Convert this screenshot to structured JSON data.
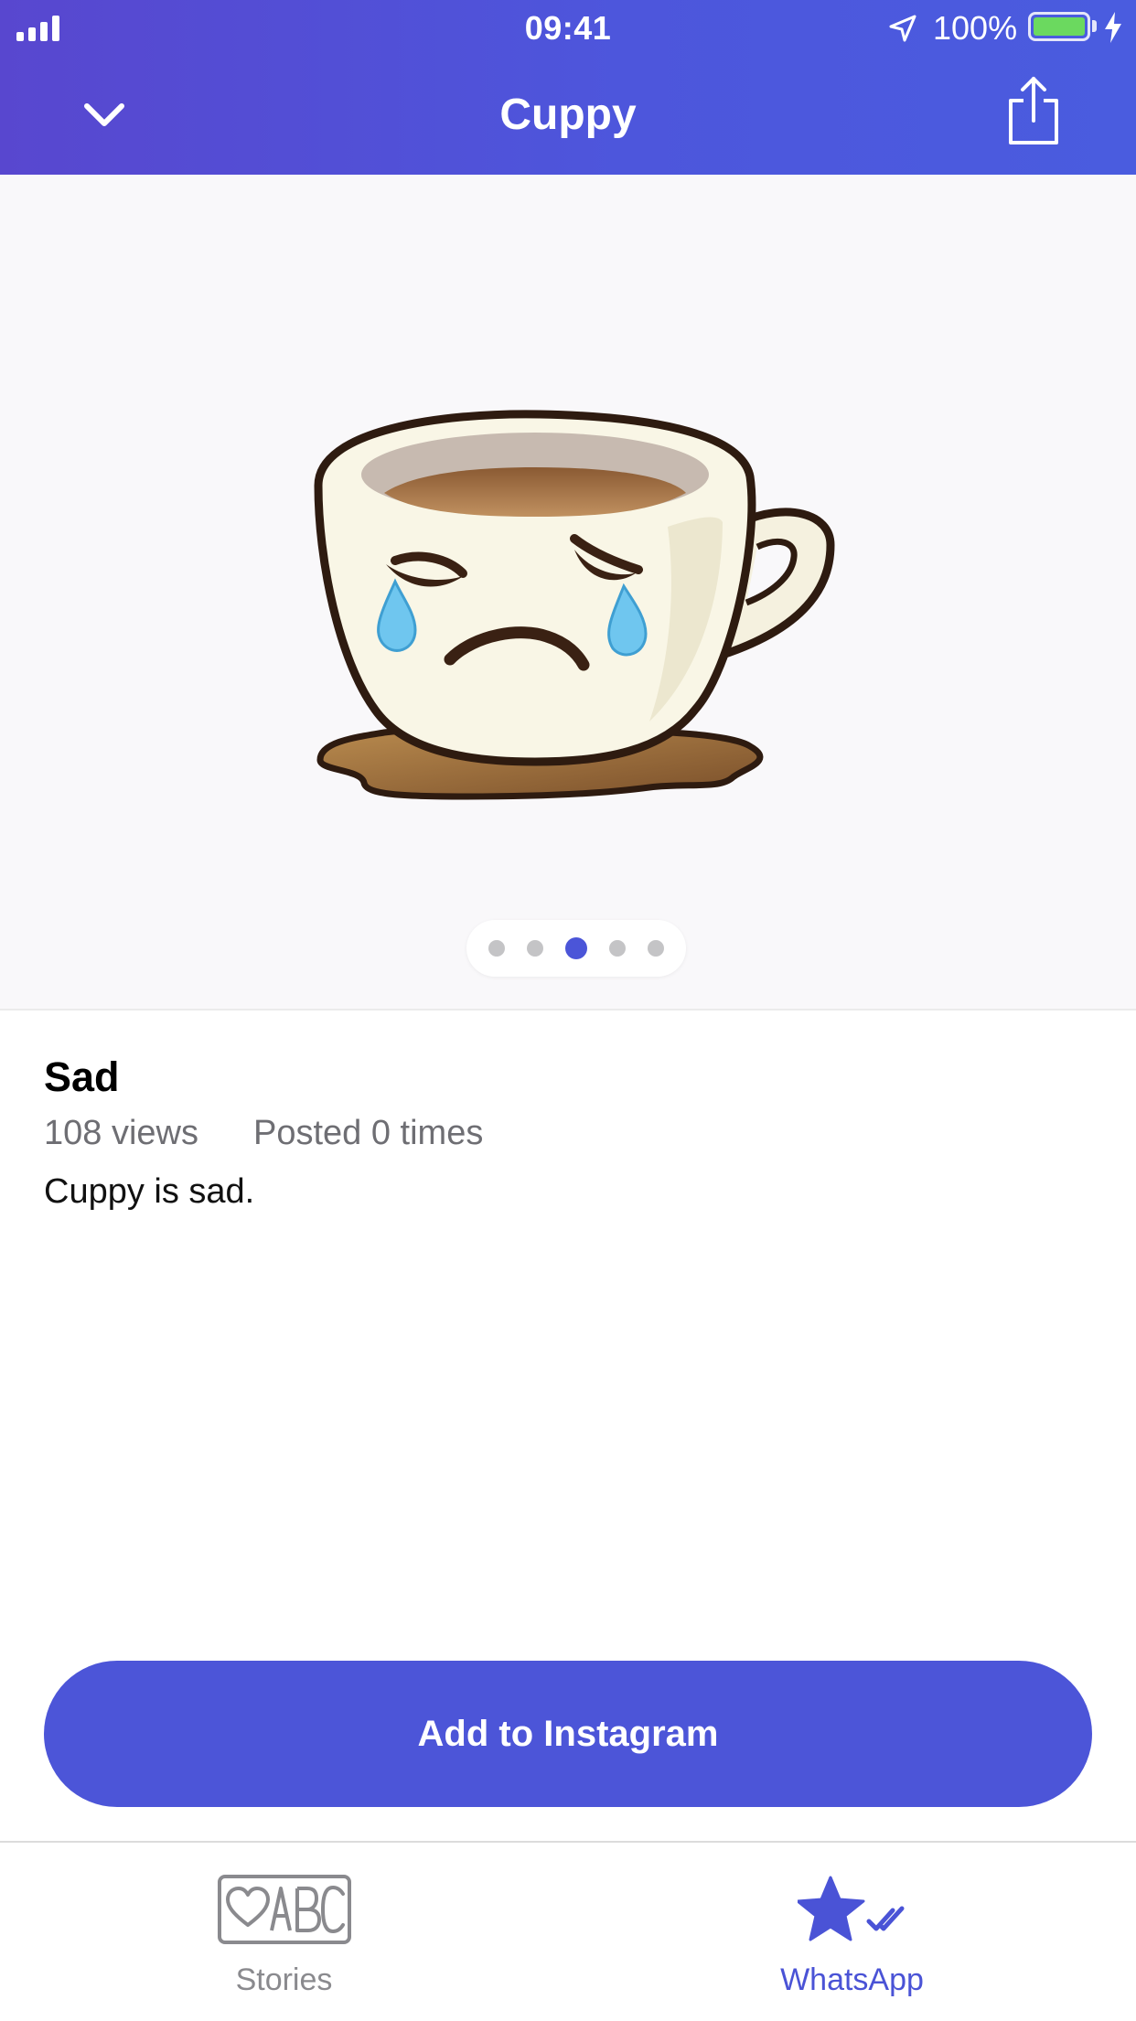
{
  "status_bar": {
    "time": "09:41",
    "battery_percent": "100%",
    "icons": [
      "signal-icon",
      "location-arrow-icon",
      "battery-icon",
      "charging-bolt-icon"
    ]
  },
  "nav": {
    "title": "Cuppy",
    "back_icon": "chevron-down-icon",
    "share_icon": "share-icon"
  },
  "sticker": {
    "icon": "sad-coffee-cup-sticker",
    "pager": {
      "count": 5,
      "active_index": 2
    }
  },
  "info": {
    "title": "Sad",
    "views": "108 views",
    "posted": "Posted 0 times",
    "description": "Cuppy is sad."
  },
  "button": {
    "label": "Add to Instagram"
  },
  "tabs": [
    {
      "label": "Stories",
      "icon": "heart-abc-icon",
      "selected": false
    },
    {
      "label": "WhatsApp",
      "icon": "star-check-icon",
      "selected": true
    }
  ],
  "colors": {
    "accent": "#4c55d8",
    "header_start": "#5847cf",
    "header_end": "#4a5cdf",
    "battery": "#6bd95f",
    "inactive": "#8a8a8e"
  }
}
